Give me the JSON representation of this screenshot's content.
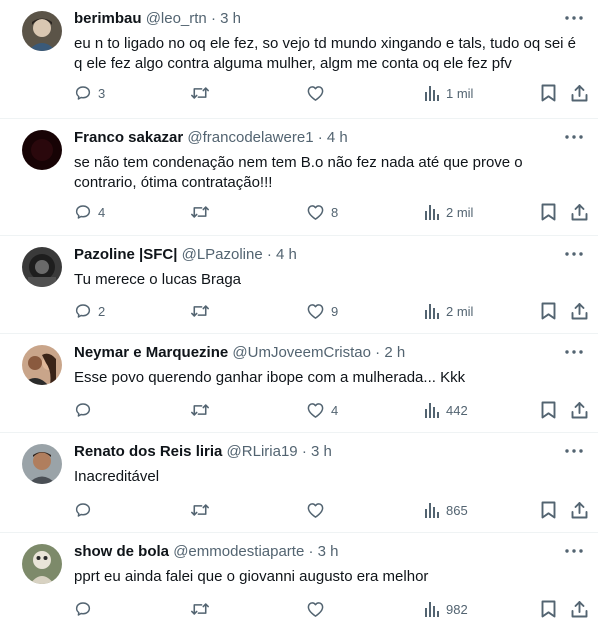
{
  "tweets": [
    {
      "name": "berimbau",
      "handle": "@leo_rtn",
      "separator": "·",
      "time": "3 h",
      "text": "eu n to ligado no oq ele fez, so vejo td mundo xingando e tals, tudo oq sei é q ele fez algo contra alguma mulher, algm me conta oq ele fez pfv",
      "replies": "3",
      "retweets": "",
      "likes": "",
      "views": "1 mil"
    },
    {
      "name": "Franco sakazar",
      "handle": "@francodelawere1",
      "separator": "·",
      "time": "4 h",
      "text": "se não tem condenação nem tem B.o não fez nada até que prove o contrario, ótima contratação!!!",
      "replies": "4",
      "retweets": "",
      "likes": "8",
      "views": "2 mil"
    },
    {
      "name": "Pazoline |SFC|",
      "handle": "@LPazoline",
      "separator": "·",
      "time": "4 h",
      "text": "Tu merece o lucas Braga",
      "replies": "2",
      "retweets": "",
      "likes": "9",
      "views": "2 mil"
    },
    {
      "name": "Neymar e Marquezine",
      "handle": "@UmJoveemCristao",
      "separator": "·",
      "time": "2 h",
      "text": "Esse povo querendo ganhar ibope com a mulherada... Kkk",
      "replies": "",
      "retweets": "",
      "likes": "4",
      "views": "442"
    },
    {
      "name": "Renato dos Reis liria",
      "handle": "@RLiria19",
      "separator": "·",
      "time": "3 h",
      "text": "Inacreditável",
      "replies": "",
      "retweets": "",
      "likes": "",
      "views": "865"
    },
    {
      "name": "show de bola",
      "handle": "@emmodestiaparte",
      "separator": "·",
      "time": "3 h",
      "text": "pprt eu ainda falei que o giovanni augusto era melhor",
      "replies": "",
      "retweets": "",
      "likes": "",
      "views": "982"
    }
  ],
  "colors": {
    "text_primary": "#0f1419",
    "text_secondary": "#536471",
    "divider": "#eff3f4"
  },
  "icons": [
    "more-icon",
    "reply-icon",
    "retweet-icon",
    "like-icon",
    "views-icon",
    "bookmark-icon",
    "share-icon"
  ]
}
